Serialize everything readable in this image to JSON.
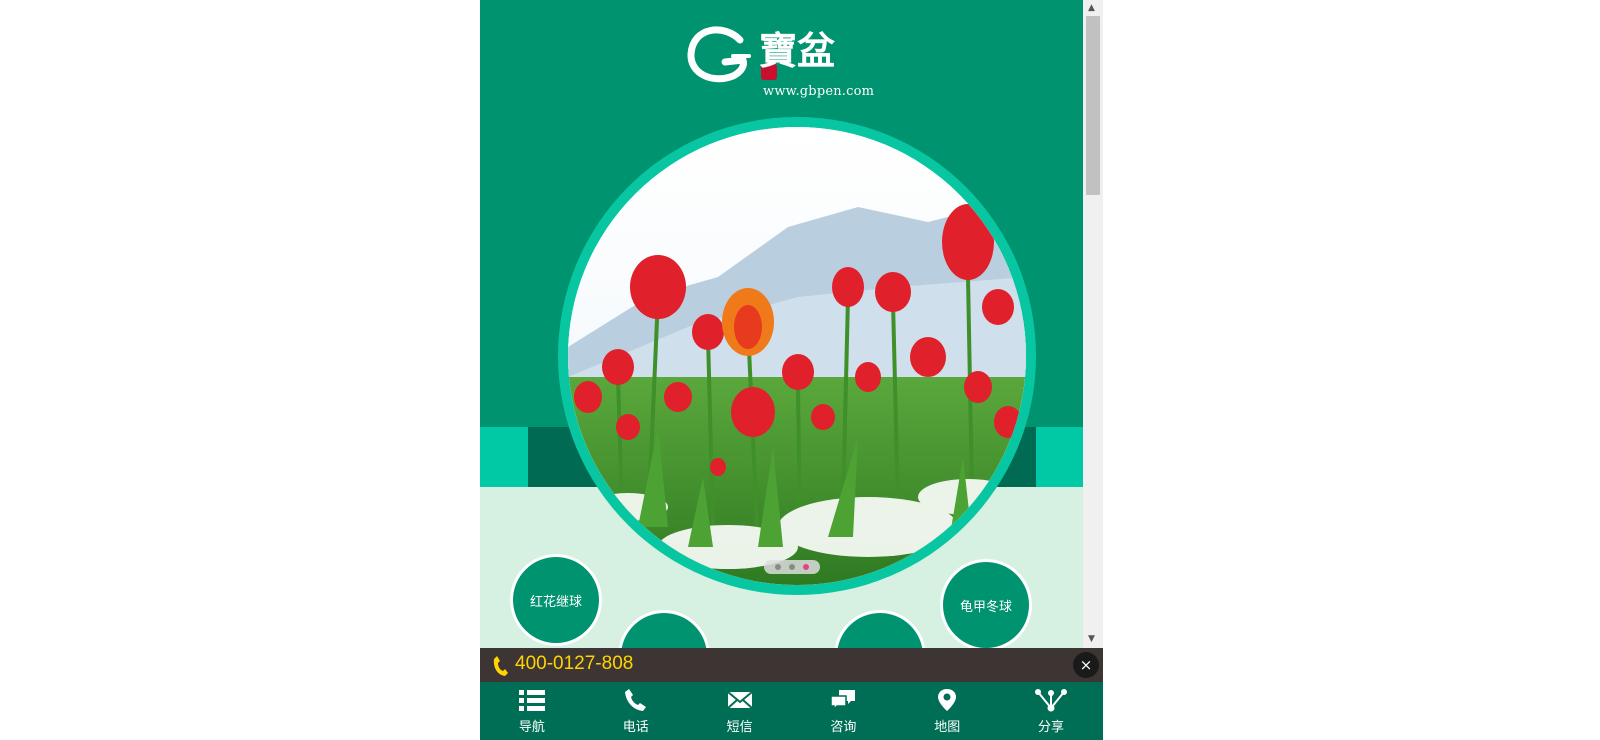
{
  "logo": {
    "brand_chars": "寶盆",
    "url": "www.gbpen.com"
  },
  "slider": {
    "slide_count": 3,
    "active_slide": 3
  },
  "categories": [
    {
      "label": "红花继球"
    },
    {
      "label": ""
    },
    {
      "label": ""
    },
    {
      "label": "龟甲冬球"
    }
  ],
  "phone_bar": {
    "number": "400-0127-808",
    "close_label": "×"
  },
  "bottom_nav": {
    "items": [
      {
        "label": "导航",
        "icon": "list-icon"
      },
      {
        "label": "电话",
        "icon": "phone-icon"
      },
      {
        "label": "短信",
        "icon": "envelope-icon"
      },
      {
        "label": "咨询",
        "icon": "chat-icon"
      },
      {
        "label": "地图",
        "icon": "map-pin-icon"
      },
      {
        "label": "分享",
        "icon": "share-icon"
      }
    ]
  },
  "colors": {
    "header_green": "#00936f",
    "ring_teal": "#08c6a2",
    "dark_green": "#006a53",
    "light_mint": "#d6f0e2",
    "phone_bar_bg": "#3d3534",
    "phone_number": "#ffd400"
  }
}
